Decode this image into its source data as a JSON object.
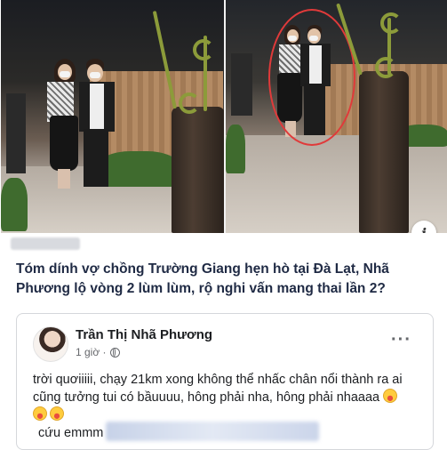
{
  "photo": {
    "left_panel_desc": "couple-walking-at-night",
    "right_panel_desc": "couple-highlighted",
    "highlight_color": "#e03a3a"
  },
  "info_button": {
    "label": "i",
    "icon": "info-icon"
  },
  "article": {
    "headline": "Tóm dính vợ chồng Trường Giang hẹn hò tại Đà Lạt, Nhã Phương lộ vòng 2 lùm lùm, rộ nghi vấn mang thai lần 2?"
  },
  "post": {
    "author": "Trần Thị Nhã Phương",
    "time": "1 giờ ·",
    "privacy_icon": "globe-icon",
    "more_label": "···",
    "text": "trời quơiiiii, chạy 21km xong không thể nhấc chân nổi thành ra ai cũng tưởng tui có bầuuuu, hông phải nha, hông phải nhaaaa",
    "emoji": "laughing-emoji",
    "signature": "cứu emmm"
  },
  "colors": {
    "headline": "#1f2a44",
    "card_border": "#d5d7db",
    "meta_text": "#65676b"
  }
}
